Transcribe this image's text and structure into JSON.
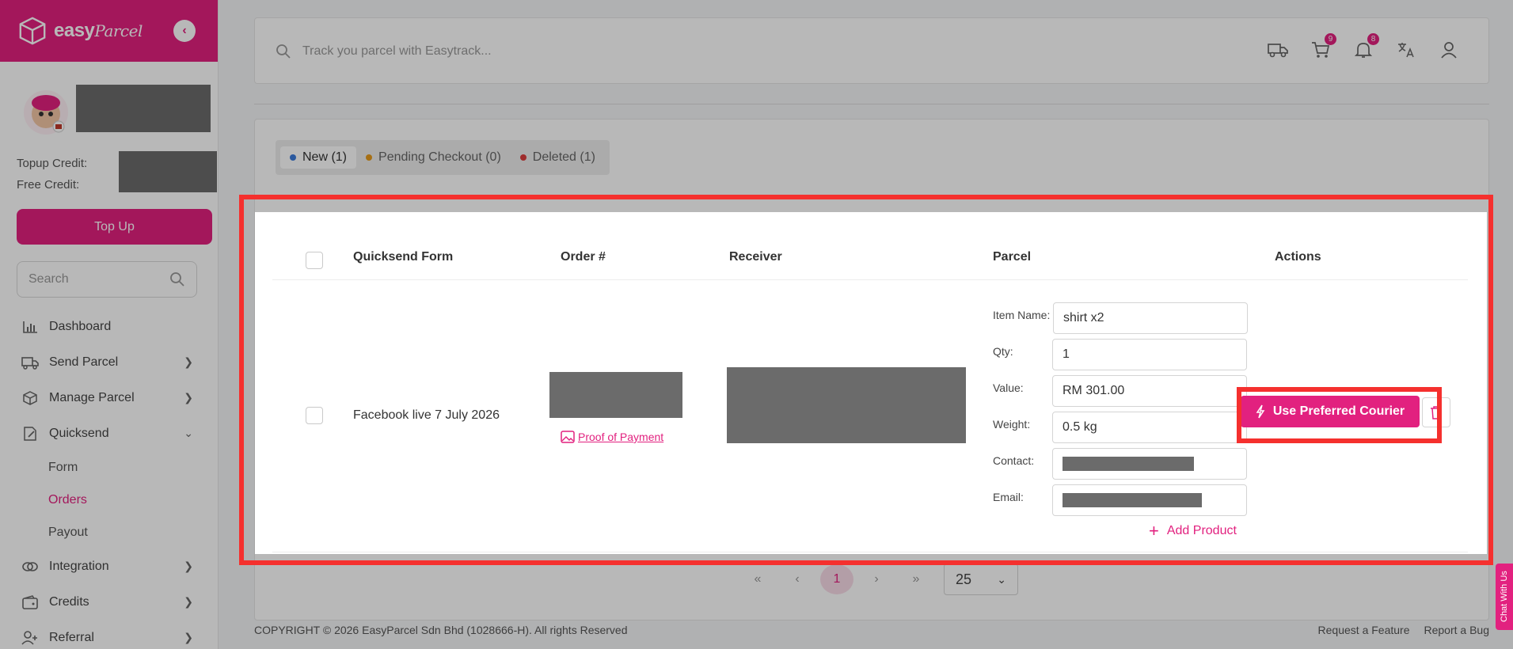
{
  "brand": {
    "name": "easy",
    "name_script": "Parcel"
  },
  "profile": {
    "topup_credit_label": "Topup Credit:",
    "free_credit_label": "Free Credit:",
    "topup_button": "Top Up"
  },
  "sidebar": {
    "search_placeholder": "Search",
    "items": [
      {
        "label": "Dashboard",
        "icon": "chart-icon"
      },
      {
        "label": "Send Parcel",
        "icon": "truck-icon"
      },
      {
        "label": "Manage Parcel",
        "icon": "box-icon"
      },
      {
        "label": "Quicksend",
        "icon": "form-icon"
      },
      {
        "label": "Integration",
        "icon": "link-icon"
      },
      {
        "label": "Credits",
        "icon": "wallet-icon"
      },
      {
        "label": "Referral",
        "icon": "user-plus-icon"
      }
    ],
    "subitems": [
      {
        "label": "Form"
      },
      {
        "label": "Orders"
      },
      {
        "label": "Payout"
      }
    ]
  },
  "topbar": {
    "search_placeholder": "Track you parcel with Easytrack...",
    "cart_badge": "9",
    "notif_badge": "8"
  },
  "tabs": [
    {
      "label": "New (1)",
      "color": "#3b7bdc"
    },
    {
      "label": "Pending Checkout (0)",
      "color": "#e69a1c"
    },
    {
      "label": "Deleted (1)",
      "color": "#dc3d3d"
    }
  ],
  "table": {
    "headers": {
      "form": "Quicksend Form",
      "order": "Order #",
      "receiver": "Receiver",
      "parcel": "Parcel",
      "actions": "Actions"
    },
    "row": {
      "form": "Facebook live 7 July 2026",
      "proof": "Proof of Payment",
      "fields": {
        "item_label": "Item Name:",
        "item_value": "shirt x2",
        "qty_label": "Qty:",
        "qty_value": "1",
        "value_label": "Value:",
        "value_value": "RM 301.00",
        "weight_label": "Weight:",
        "weight_value": "0.5 kg",
        "contact_label": "Contact:",
        "email_label": "Email:"
      },
      "add_product": "Add Product",
      "preferred_button": "Use Preferred Courier"
    }
  },
  "pager": {
    "current": "1",
    "page_size": "25"
  },
  "footer": {
    "copyright": "COPYRIGHT © 2026 EasyParcel Sdn Bhd (1028666-H). All rights Reserved",
    "request": "Request a Feature",
    "report": "Report a Bug"
  },
  "chat": "Chat With Us",
  "colors": {
    "brand": "#e2217f",
    "highlight": "#f5302e"
  }
}
